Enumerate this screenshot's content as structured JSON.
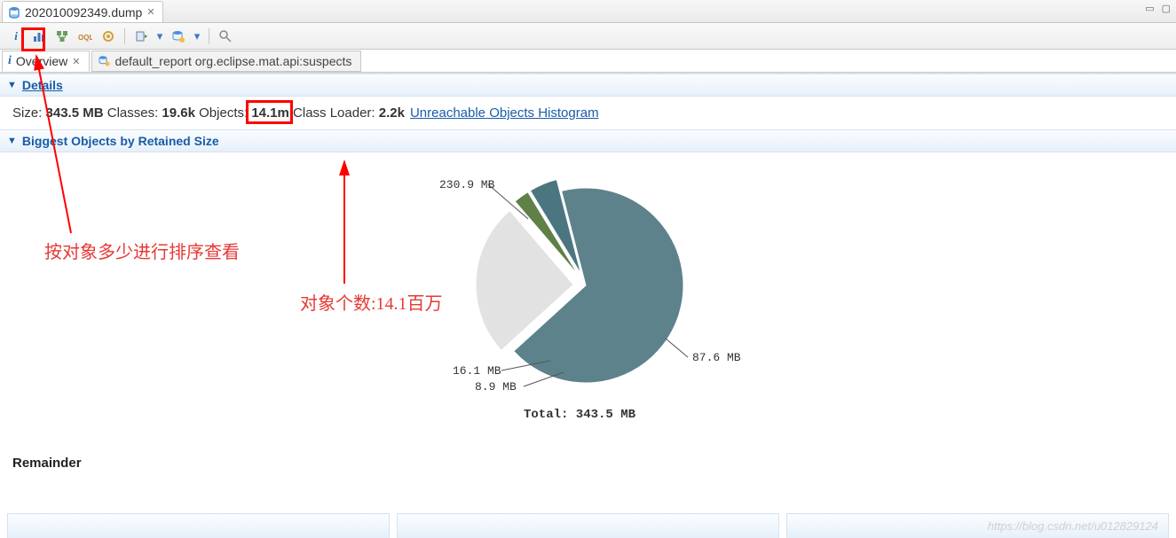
{
  "editor_tab": {
    "title": "202010092349.dump"
  },
  "sub_tabs": {
    "overview": "Overview",
    "report": "default_report  org.eclipse.mat.api:suspects"
  },
  "sections": {
    "details_title": "Details",
    "biggest_title": "Biggest Objects by Retained Size"
  },
  "details": {
    "size_label": "Size: ",
    "size_value": "343.5 MB",
    "classes_label": " Classes: ",
    "classes_value": "19.6k",
    "objects_label": " Objects: ",
    "objects_value": "14.1m",
    "classloader_label": " Class Loader: ",
    "classloader_value": "2.2k",
    "link_text": "Unreachable Objects Histogram"
  },
  "remainder_label": "Remainder",
  "annotations": {
    "sort_by_objects": "按对象多少进行排序查看",
    "objects_count": "对象个数:14.1百万"
  },
  "watermark": "https://blog.csdn.net/u012829124",
  "chart_data": {
    "type": "pie",
    "title": "",
    "total_label": "Total: 343.5 MB",
    "unit": "MB",
    "slices": [
      {
        "label": "230.9 MB",
        "value": 230.9,
        "color": "#5d828c"
      },
      {
        "label": "87.6 MB",
        "value": 87.6,
        "color": "#e2e2e2"
      },
      {
        "label": "8.9 MB",
        "value": 8.9,
        "color": "#5f8046"
      },
      {
        "label": "16.1 MB",
        "value": 16.1,
        "color": "#4b7680"
      }
    ]
  }
}
